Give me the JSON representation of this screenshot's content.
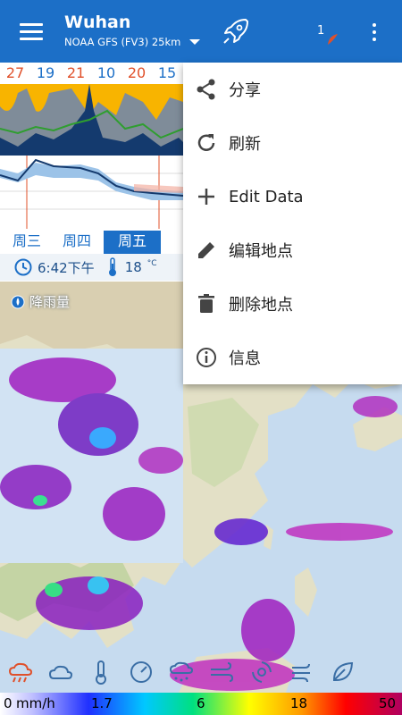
{
  "header": {
    "title": "Wuhan",
    "model": "NOAA GFS (FV3) 25km",
    "notification_count": "1"
  },
  "forecast": {
    "temps": [
      "27",
      "19",
      "21",
      "10",
      "20",
      "15"
    ],
    "temp_colors": [
      "#e0502a",
      "#1c6fc7",
      "#e0502a",
      "#1c6fc7",
      "#e0502a",
      "#1c6fc7"
    ],
    "days": [
      "周三",
      "周四",
      "周五"
    ],
    "active_day": "周五",
    "current_time": "6:42下午",
    "current_temp": "18",
    "temp_unit": "°C"
  },
  "map": {
    "layer_label": "降雨量"
  },
  "legend": {
    "ticks": [
      "0",
      "mm/h",
      "1.7",
      "6",
      "18",
      "50"
    ]
  },
  "menu": {
    "items": [
      {
        "icon": "share-icon",
        "label": "分享"
      },
      {
        "icon": "refresh-icon",
        "label": "刷新"
      },
      {
        "icon": "plus-icon",
        "label": "Edit Data"
      },
      {
        "icon": "edit-icon",
        "label": "编辑地点"
      },
      {
        "icon": "delete-icon",
        "label": "删除地点"
      },
      {
        "icon": "info-icon",
        "label": "信息"
      }
    ]
  },
  "colors": {
    "primary": "#1c6fc7",
    "warm": "#e0502a",
    "precip": "#f8b400"
  }
}
